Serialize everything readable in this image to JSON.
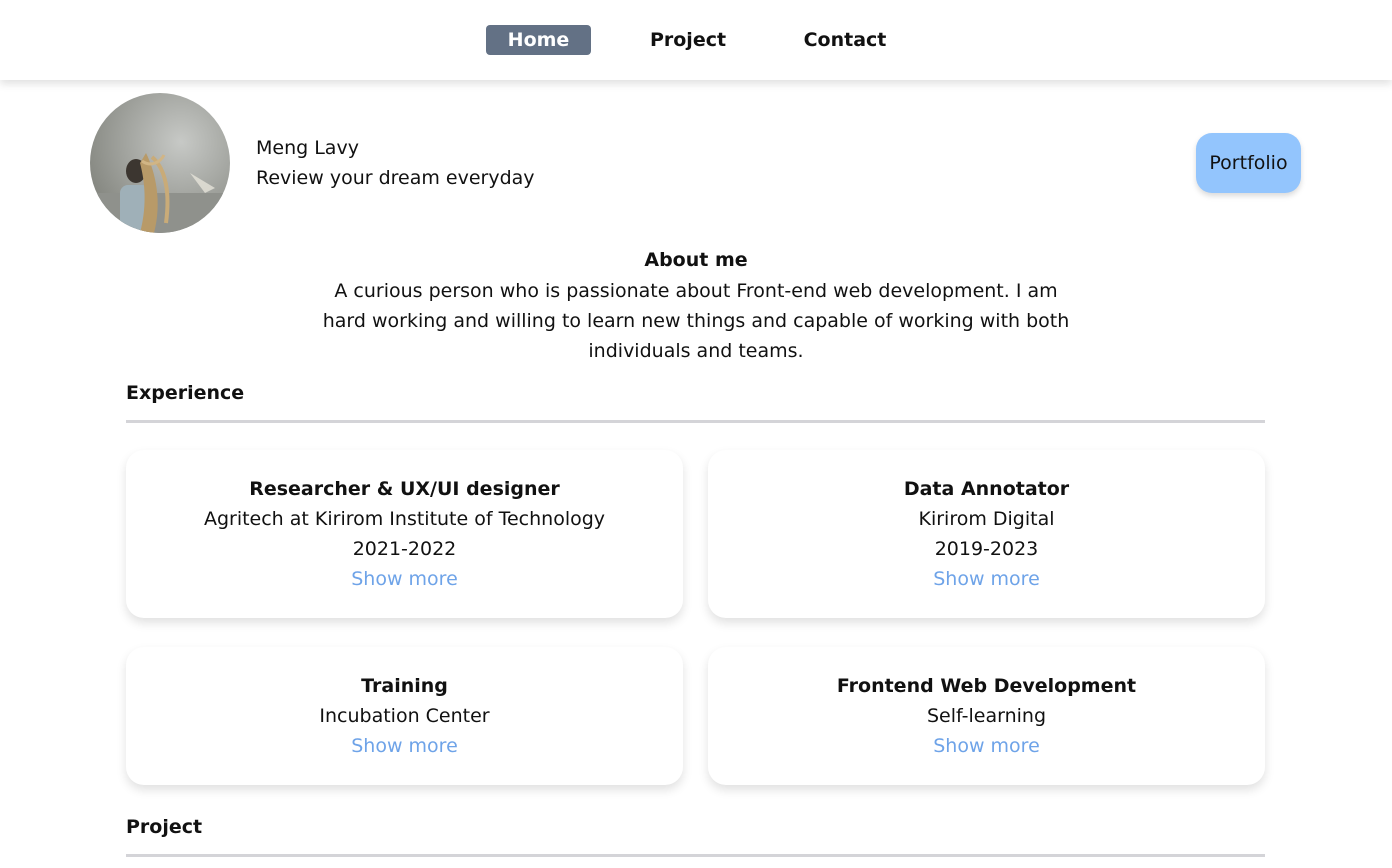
{
  "nav": {
    "items": [
      {
        "label": "Home",
        "active": true
      },
      {
        "label": "Project",
        "active": false
      },
      {
        "label": "Contact",
        "active": false
      }
    ]
  },
  "profile": {
    "name": "Meng Lavy",
    "tagline": "Review your dream everyday",
    "portfolio_label": "Portfolio"
  },
  "about": {
    "title": "About me",
    "text": "A curious person who is passionate about Front-end web development. I am hard working and willing to learn new things and capable of working with both individuals and teams."
  },
  "experience": {
    "title": "Experience",
    "cards": [
      {
        "title": "Researcher & UX/UI designer",
        "org": "Agritech at Kirirom Institute of Technology",
        "years": "2021-2022",
        "more": "Show more"
      },
      {
        "title": "Data Annotator",
        "org": "Kirirom Digital",
        "years": "2019-2023",
        "more": "Show more"
      },
      {
        "title": "Training",
        "org": "Incubation Center",
        "more": "Show more"
      },
      {
        "title": "Frontend Web Development",
        "org": "Self-learning",
        "more": "Show more"
      }
    ]
  },
  "project": {
    "title": "Project"
  },
  "colors": {
    "nav_active_bg": "#637185",
    "portfolio_button": "#93c5fd",
    "link": "#6ea3e8"
  }
}
